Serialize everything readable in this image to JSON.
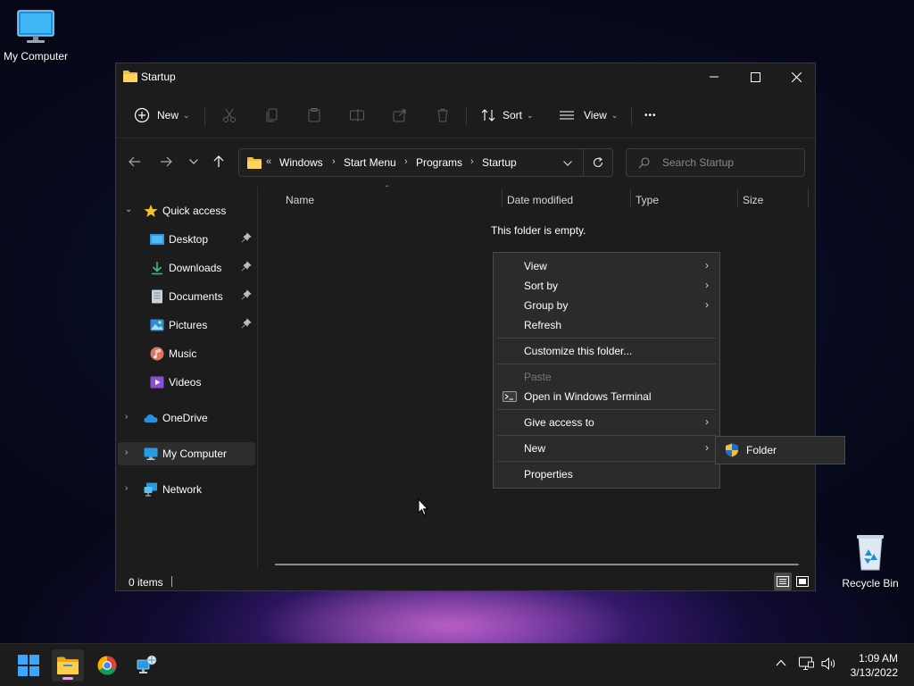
{
  "desktop": {
    "icons": [
      {
        "label": "My Computer"
      },
      {
        "label": "Recycle Bin"
      }
    ]
  },
  "window": {
    "title": "Startup",
    "toolbar": {
      "new_label": "New",
      "sort_label": "Sort",
      "view_label": "View",
      "more_label": "•••"
    },
    "address": {
      "overflow": "«",
      "crumbs": [
        "Windows",
        "Start Menu",
        "Programs",
        "Startup"
      ]
    },
    "search": {
      "placeholder": "Search Startup"
    },
    "nav": {
      "quick_access": "Quick access",
      "items": [
        {
          "label": "Desktop",
          "pinned": true
        },
        {
          "label": "Downloads",
          "pinned": true
        },
        {
          "label": "Documents",
          "pinned": true
        },
        {
          "label": "Pictures",
          "pinned": true
        },
        {
          "label": "Music",
          "pinned": false
        },
        {
          "label": "Videos",
          "pinned": false
        }
      ],
      "onedrive": "OneDrive",
      "my_computer": "My Computer",
      "network": "Network"
    },
    "columns": {
      "name": "Name",
      "date_modified": "Date modified",
      "type": "Type",
      "size": "Size"
    },
    "empty_message": "This folder is empty.",
    "status": {
      "item_count": "0 items"
    }
  },
  "context_menu": {
    "items": [
      {
        "label": "View",
        "submenu": true
      },
      {
        "label": "Sort by",
        "submenu": true
      },
      {
        "label": "Group by",
        "submenu": true
      },
      {
        "label": "Refresh",
        "submenu": false
      },
      {
        "label": "Customize this folder...",
        "submenu": false
      },
      {
        "label": "Paste",
        "submenu": false,
        "disabled": true
      },
      {
        "label": "Open in Windows Terminal",
        "submenu": false
      },
      {
        "label": "Give access to",
        "submenu": true
      },
      {
        "label": "New",
        "submenu": true
      },
      {
        "label": "Properties",
        "submenu": false
      }
    ],
    "new_submenu": {
      "label": "Folder"
    }
  },
  "taskbar": {
    "time": "1:09 AM",
    "date": "3/13/2022"
  },
  "colors": {
    "accent": "#0078d4",
    "folder": "#f0c040",
    "window_bg": "#1c1c1c",
    "menu_bg": "#2b2b2b"
  }
}
